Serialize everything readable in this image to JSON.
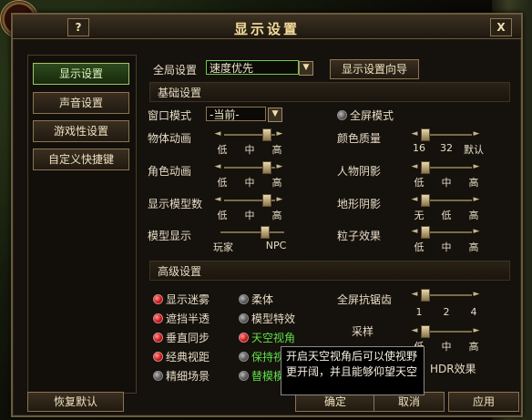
{
  "window": {
    "title": "显示设置",
    "help_label": "?",
    "close_label": "X"
  },
  "sidebar": {
    "items": [
      {
        "label": "显示设置",
        "active": true
      },
      {
        "label": "声音设置"
      },
      {
        "label": "游戏性设置"
      },
      {
        "label": "自定义快捷键"
      }
    ]
  },
  "top": {
    "global_label": "全局设置",
    "global_value": "速度优先",
    "wizard_button": "显示设置向导"
  },
  "basic": {
    "header": "基础设置",
    "window_mode_label": "窗口模式",
    "window_mode_value": "-当前-",
    "fullscreen_label": "全屏模式",
    "sliders": {
      "object_anim": {
        "label": "物体动画",
        "ticks": [
          "低",
          "中",
          "高"
        ]
      },
      "color_quality": {
        "label": "颜色质量",
        "ticks": [
          "16",
          "32",
          "默认"
        ]
      },
      "char_anim": {
        "label": "角色动画",
        "ticks": [
          "低",
          "中",
          "高"
        ]
      },
      "char_shadow": {
        "label": "人物阴影",
        "ticks": [
          "低",
          "中",
          "高"
        ]
      },
      "model_count": {
        "label": "显示模型数",
        "ticks": [
          "低",
          "中",
          "高"
        ]
      },
      "terrain_shadow": {
        "label": "地形阴影",
        "ticks": [
          "无",
          "低",
          "高"
        ]
      },
      "model_display": {
        "label": "模型显示",
        "ticks": [
          "玩家",
          "NPC"
        ]
      },
      "particle": {
        "label": "粒子效果",
        "ticks": [
          "低",
          "中",
          "高"
        ]
      }
    }
  },
  "advanced": {
    "header": "高级设置",
    "options": {
      "fog": "显示迷雾",
      "soft": "柔体",
      "occlude": "遮挡半透",
      "model_fx": "模型特效",
      "vsync": "垂直同步",
      "sky_view": "天空视角",
      "classic_view": "经典视距",
      "keep_view": "保持视",
      "fine_scene": "精细场景",
      "replace_model": "替模模"
    },
    "aa": {
      "label": "全屏抗锯齿",
      "ticks": [
        "1",
        "2",
        "4"
      ]
    },
    "sampling": {
      "label": "采样",
      "ticks": [
        "低",
        "中",
        "高"
      ]
    },
    "hdr_label": "HDR效果"
  },
  "footer": {
    "restore": "恢复默认",
    "ok": "确定",
    "cancel": "取消",
    "apply": "应用"
  },
  "tooltip": {
    "text": "开启天空视角后可以使视野更开阔，并且能够仰望天空"
  }
}
